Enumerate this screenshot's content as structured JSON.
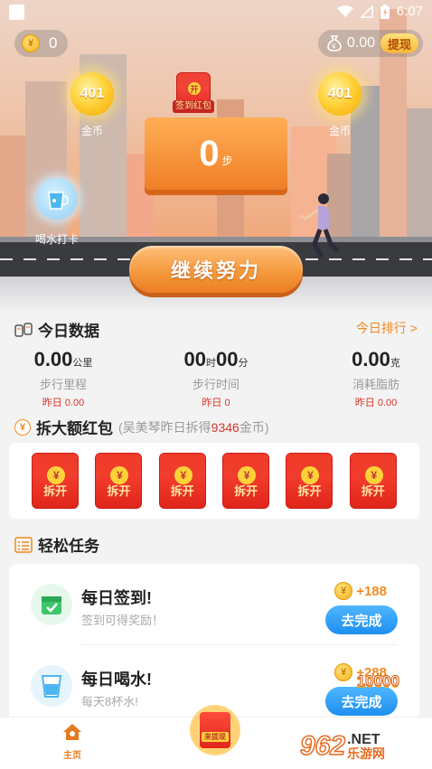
{
  "status_bar": {
    "time": "6:07"
  },
  "hero": {
    "coin_balance": "0",
    "cash_balance": "0.00",
    "withdraw_label": "提现",
    "bubble_left": {
      "value": "401",
      "label": "金币"
    },
    "bubble_right": {
      "value": "401",
      "label": "金币"
    },
    "sign_red_envelope_label": "签到红包",
    "steps": "0",
    "steps_unit": "步",
    "water_label": "喝水打卡",
    "continue_label": "继续努力"
  },
  "today": {
    "title": "今日数据",
    "rank_link": "今日排行 >",
    "stats": [
      {
        "value": "0.00",
        "unit": "公里",
        "label": "步行里程",
        "yesterday": "昨日 0.00"
      },
      {
        "value_h": "00",
        "unit_h": "时",
        "value_m": "00",
        "unit_m": "分",
        "label": "步行时间",
        "yesterday": "昨日 0"
      },
      {
        "value": "0.00",
        "unit": "克",
        "label": "消耗脂肪",
        "yesterday": "昨日 0.00"
      }
    ]
  },
  "big_hongbao": {
    "title": "拆大额红包",
    "subtitle_prefix": "(吴美琴昨日拆得",
    "subtitle_amount": "9346",
    "subtitle_suffix": "金币)",
    "open_label": "拆开",
    "envelopes": 6
  },
  "tasks": {
    "title": "轻松任务",
    "items": [
      {
        "title": "每日签到!",
        "desc": "签到可得奖励！",
        "reward": "+188",
        "button": "去完成"
      },
      {
        "title": "每日喝水!",
        "desc": "每天8杯水!",
        "reward": "+288",
        "button": "去完成"
      }
    ],
    "bonus_badge": "10000"
  },
  "nav": {
    "home_label": "主页",
    "fab_label": "来提现"
  },
  "watermark": {
    "num": "962",
    "net": ".NET",
    "site": "乐游网"
  }
}
